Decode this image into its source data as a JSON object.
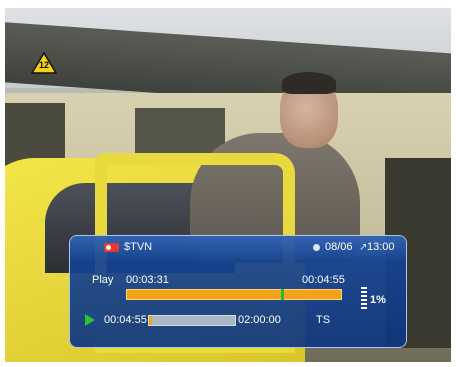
{
  "rating": {
    "label": "12"
  },
  "osd": {
    "channel": "$TVN",
    "date": "08/06",
    "time": "13:00",
    "play_label": "Play",
    "position": "00:03:31",
    "total": "00:04:55",
    "progress_fraction": 0.72,
    "buffer_percent": "1%",
    "timeshift": {
      "start": "00:04:55",
      "end": "02:00:00",
      "fill_fraction": 0.04,
      "label": "TS"
    }
  },
  "colors": {
    "osd_background": "#1646a0",
    "progress": "#f3a21a",
    "marker": "#1fbf3a",
    "record": "#e53a2e"
  },
  "icons": {
    "record": "record-icon",
    "clock": "clock-icon",
    "time": "time-icon",
    "play": "play-icon",
    "buffer": "buffer-level-icon",
    "rating": "age-rating-icon"
  }
}
